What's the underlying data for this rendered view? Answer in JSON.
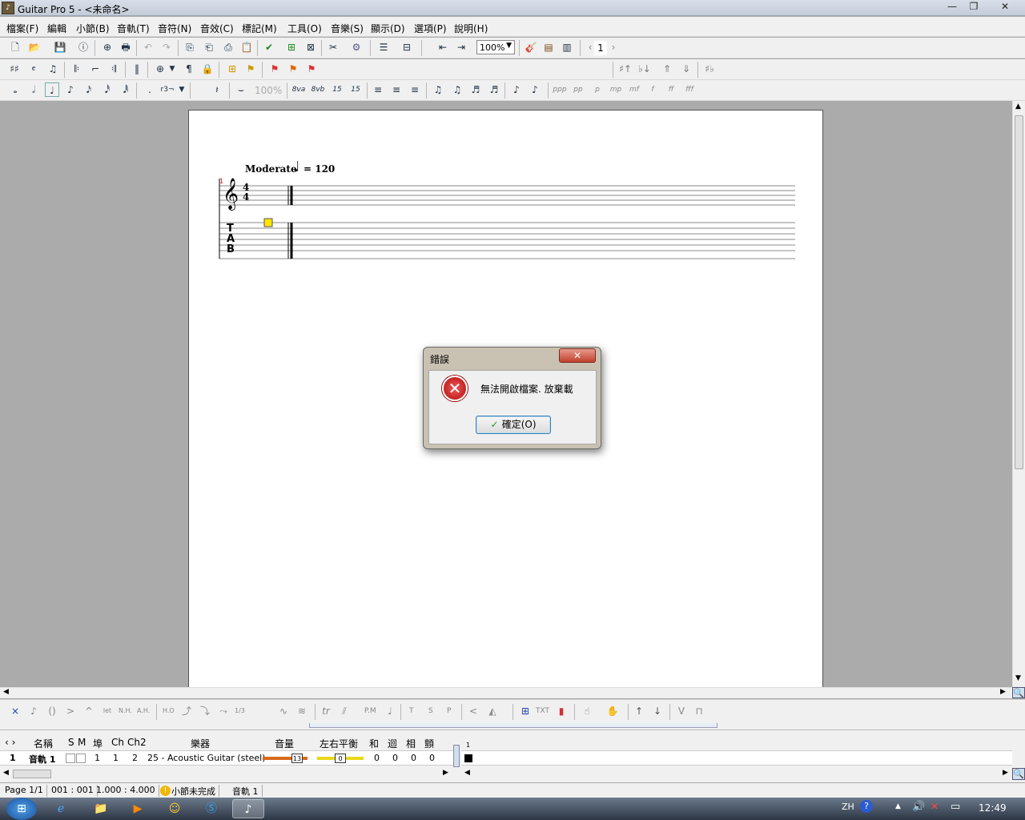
{
  "window": {
    "title": "Guitar Pro 5 - <未命名>",
    "minimize": "—",
    "restore": "❐",
    "close": "✕"
  },
  "menu": [
    "檔案(F)",
    "編輯",
    "小節(B)",
    "音軌(T)",
    "音符(N)",
    "音效(C)",
    "標記(M)",
    "工具(O)",
    "音樂(S)",
    "顯示(D)",
    "選項(P)",
    "說明(H)"
  ],
  "toolbar": {
    "zoom": "100%",
    "page_number": "1",
    "volume_percent": "100%"
  },
  "score": {
    "tempo_label": "Moderate",
    "tempo_value": "= 120",
    "bar_number": "1",
    "time_sig_top": "4",
    "time_sig_bottom": "4",
    "tab_label": [
      "T",
      "A",
      "B"
    ]
  },
  "dialog": {
    "title": "錯誤",
    "message": "無法開啟檔案. 放棄載",
    "ok_label": "確定(O)",
    "close": "✕"
  },
  "effects_bar": {
    "labels": [
      "N.H.",
      "A.H.",
      "H.O",
      "1/3",
      "P.M",
      "T",
      "S",
      "P",
      "TXT"
    ]
  },
  "tracks": {
    "headers": [
      "名稱",
      "S",
      "M",
      "埠",
      "Ch",
      "Ch2",
      "樂器",
      "音量",
      "左右平衡",
      "和",
      "迴",
      "相",
      "顫"
    ],
    "row": {
      "index": "1",
      "name": "音軌 1",
      "port": "1",
      "channel": "1",
      "channel2": "2",
      "instrument": "25 - Acoustic Guitar (steel)",
      "volume": "13",
      "pan": "0",
      "chorus": "0",
      "reverb": "0",
      "phaser": "0",
      "tremolo": "0"
    },
    "measure_number": "1"
  },
  "status": {
    "page": "Page 1/1",
    "position": "001 : 001",
    "duration": "1.000 : 4.000",
    "message": "小節未完成",
    "track": "音軌 1"
  },
  "taskbar": {
    "lang": "ZH",
    "clock": "12:49"
  }
}
